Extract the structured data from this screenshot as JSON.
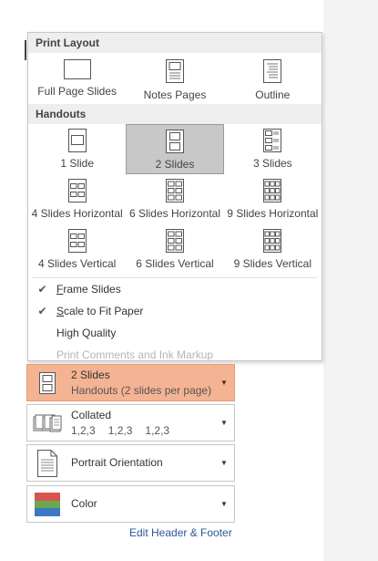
{
  "dropdown": {
    "print_layout_header": "Print Layout",
    "print_layout_items": [
      {
        "label": "Full Page Slides",
        "icon": "full-page-slide-icon"
      },
      {
        "label": "Notes Pages",
        "icon": "notes-pages-icon"
      },
      {
        "label": "Outline",
        "icon": "outline-icon"
      }
    ],
    "handouts_header": "Handouts",
    "handouts_items": [
      {
        "label": "1 Slide"
      },
      {
        "label": "2 Slides",
        "selected": true
      },
      {
        "label": "3 Slides"
      },
      {
        "label": "4 Slides Horizontal"
      },
      {
        "label": "6 Slides Horizontal"
      },
      {
        "label": "9 Slides Horizontal"
      },
      {
        "label": "4 Slides Vertical"
      },
      {
        "label": "6 Slides Vertical"
      },
      {
        "label": "9 Slides Vertical"
      }
    ],
    "options": {
      "frame_slides": {
        "first": "F",
        "rest": "rame Slides",
        "checked": true
      },
      "scale_to_fit": {
        "first": "S",
        "rest": "cale to Fit Paper",
        "checked": true
      },
      "high_quality": "High Quality",
      "print_comments": "Print Comments and Ink Markup"
    }
  },
  "settings": {
    "layout": {
      "title": "2 Slides",
      "subtitle": "Handouts (2 slides per page)"
    },
    "collate": {
      "title": "Collated",
      "sequence": [
        "1,2,3",
        "1,2,3",
        "1,2,3"
      ]
    },
    "orientation": {
      "title": "Portrait Orientation"
    },
    "color": {
      "title": "Color"
    }
  },
  "edit_header_footer": "Edit Header & Footer",
  "colors": {
    "selected_bg": "#c8c8c8",
    "active_setting_bg": "#f4b393",
    "link": "#2b5797"
  }
}
